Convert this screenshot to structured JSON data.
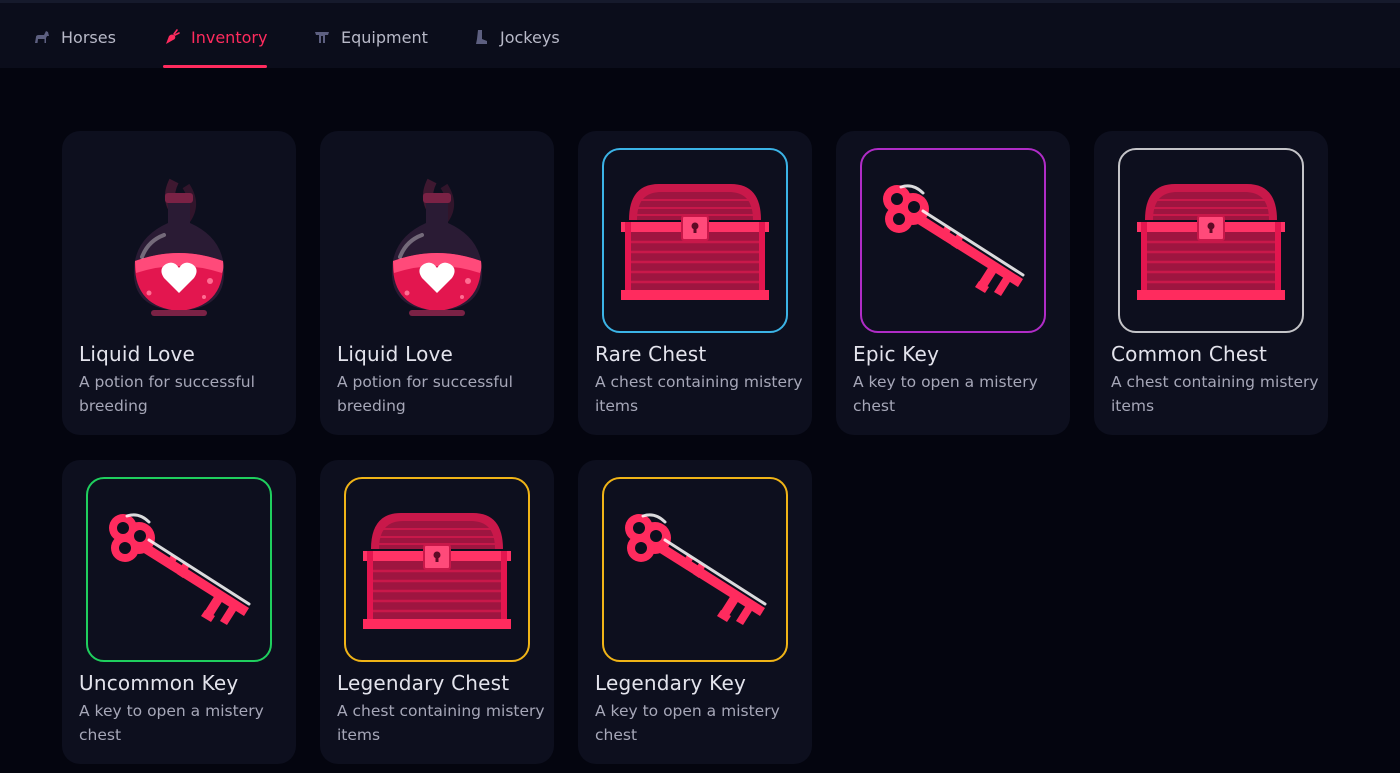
{
  "nav": {
    "tabs": [
      {
        "label": "Horses",
        "icon": "horse-icon",
        "active": false
      },
      {
        "label": "Inventory",
        "icon": "carrot-icon",
        "active": true
      },
      {
        "label": "Equipment",
        "icon": "saddle-icon",
        "active": false
      },
      {
        "label": "Jockeys",
        "icon": "boot-icon",
        "active": false
      }
    ],
    "active_color": "#ff2b5e"
  },
  "items": [
    {
      "name": "Liquid Love",
      "desc": "A potion for successful breeding",
      "kind": "potion-icon",
      "rarity_color": null
    },
    {
      "name": "Liquid Love",
      "desc": "A potion for successful breeding",
      "kind": "potion-icon",
      "rarity_color": null
    },
    {
      "name": "Rare Chest",
      "desc": "A chest containing mistery items",
      "kind": "chest-icon",
      "rarity_color": "#3bb3e6"
    },
    {
      "name": "Epic Key",
      "desc": "A key to open a mistery chest",
      "kind": "key-icon",
      "rarity_color": "#b02cc7"
    },
    {
      "name": "Common Chest",
      "desc": "A chest containing mistery items",
      "kind": "chest-icon",
      "rarity_color": "#c4c4c8"
    },
    {
      "name": "Uncommon Key",
      "desc": "A key to open a mistery chest",
      "kind": "key-icon",
      "rarity_color": "#1fcf5e"
    },
    {
      "name": "Legendary Chest",
      "desc": "A chest containing mistery items",
      "kind": "chest-icon",
      "rarity_color": "#f0b417"
    },
    {
      "name": "Legendary Key",
      "desc": "A key to open a mistery chest",
      "kind": "key-icon",
      "rarity_color": "#f0b417"
    }
  ]
}
